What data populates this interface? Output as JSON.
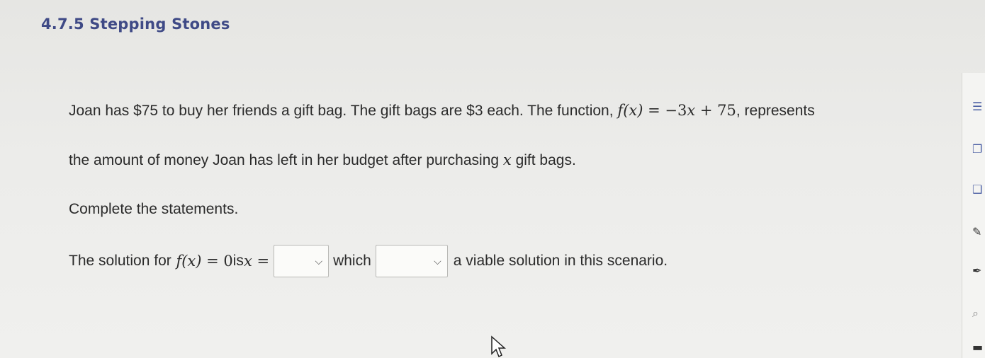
{
  "header": {
    "title": "4.7.5 Stepping Stones"
  },
  "problem": {
    "line1_text": "Joan has $75 to buy her friends a gift bag. The gift bags are $3 each. The function,",
    "line1_fx": "f(x)",
    "line1_eq": " = −3",
    "line1_x": "x",
    "line1_rest": " + 75",
    "line1_after": ", represents",
    "line2_a": "the amount of money Joan has left in her budget after purchasing ",
    "line2_x": "x",
    "line2_b": " gift bags.",
    "instruction": "Complete the statements.",
    "statement": {
      "prefix": "The solution for ",
      "fx": "f(x)",
      "eq0": " = 0",
      "is": " is ",
      "x": "x",
      "eq": " =",
      "dropdown1_value": "",
      "which": "which",
      "dropdown2_value": "",
      "suffix": "a viable solution in this scenario."
    }
  },
  "sidebar": {
    "icons": [
      "page-icon",
      "bookmark-icon",
      "note-icon",
      "pen-icon",
      "highlighter-icon",
      "zoom-icon",
      "minimize-icon"
    ]
  }
}
